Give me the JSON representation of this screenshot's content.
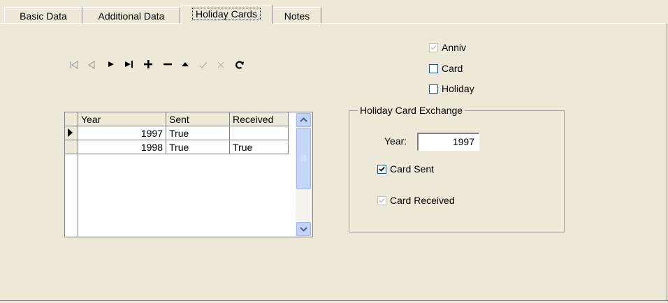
{
  "tabs": [
    "Basic Data",
    "Additional Data",
    "Holiday Cards",
    "Notes"
  ],
  "navigator": {
    "buttons": [
      "first-icon",
      "prior-icon",
      "next-icon",
      "last-icon",
      "insert-icon",
      "delete-icon",
      "edit-icon",
      "post-icon",
      "cancel-icon",
      "refresh-icon"
    ]
  },
  "filters": {
    "anniv": {
      "label": "Anniv",
      "checked": true,
      "enabled": false
    },
    "card": {
      "label": "Card",
      "checked": false,
      "enabled": true
    },
    "holiday": {
      "label": "Holiday",
      "checked": false,
      "enabled": true
    }
  },
  "grid": {
    "columns": [
      "Year",
      "Sent",
      "Received"
    ],
    "rows": [
      {
        "year": "1997",
        "sent": "True",
        "received": ""
      },
      {
        "year": "1998",
        "sent": "True",
        "received": "True"
      }
    ]
  },
  "exchange": {
    "title": "Holiday Card Exchange",
    "year_label": "Year:",
    "year_value": "1997",
    "card_sent": {
      "label": "Card Sent",
      "checked": true,
      "enabled": true
    },
    "card_received": {
      "label": "Card Received",
      "checked": true,
      "enabled": false
    }
  }
}
